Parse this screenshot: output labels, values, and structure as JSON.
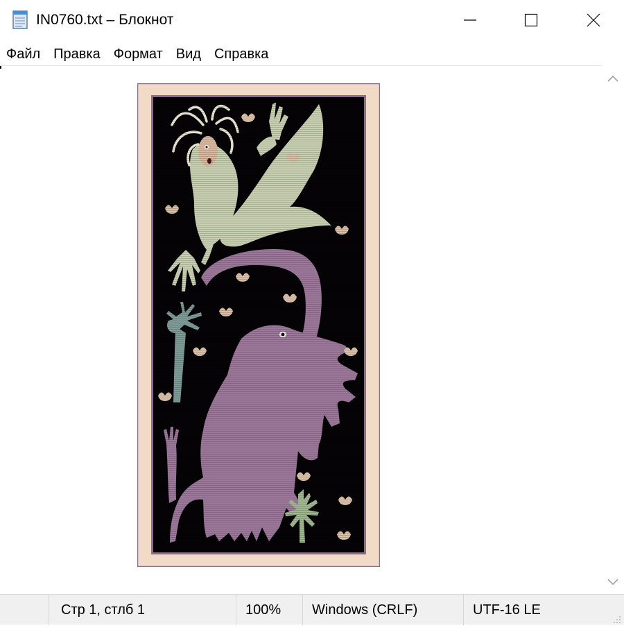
{
  "window": {
    "title": "IN0760.txt – Блокнот",
    "icon": "notepad-icon",
    "controls": {
      "minimize": "minimize-icon",
      "maximize": "maximize-icon",
      "close": "close-icon"
    }
  },
  "menu": {
    "items": [
      "Файл",
      "Правка",
      "Формат",
      "Вид",
      "Справка"
    ]
  },
  "status": {
    "position": "Стр 1, стлб 1",
    "zoom": "100%",
    "line_endings": "Windows (CRLF)",
    "encoding": "UTF-16 LE"
  },
  "colors": {
    "frame_outer": "#f1dac6",
    "frame_border": "#8a6f87",
    "background": "#050305",
    "mermaid": "#c7cfb1",
    "elephant": "#9b7799",
    "tree": "#7e9a96",
    "plant": "#9fb68f",
    "accent_peach": "#d9bfa6"
  }
}
